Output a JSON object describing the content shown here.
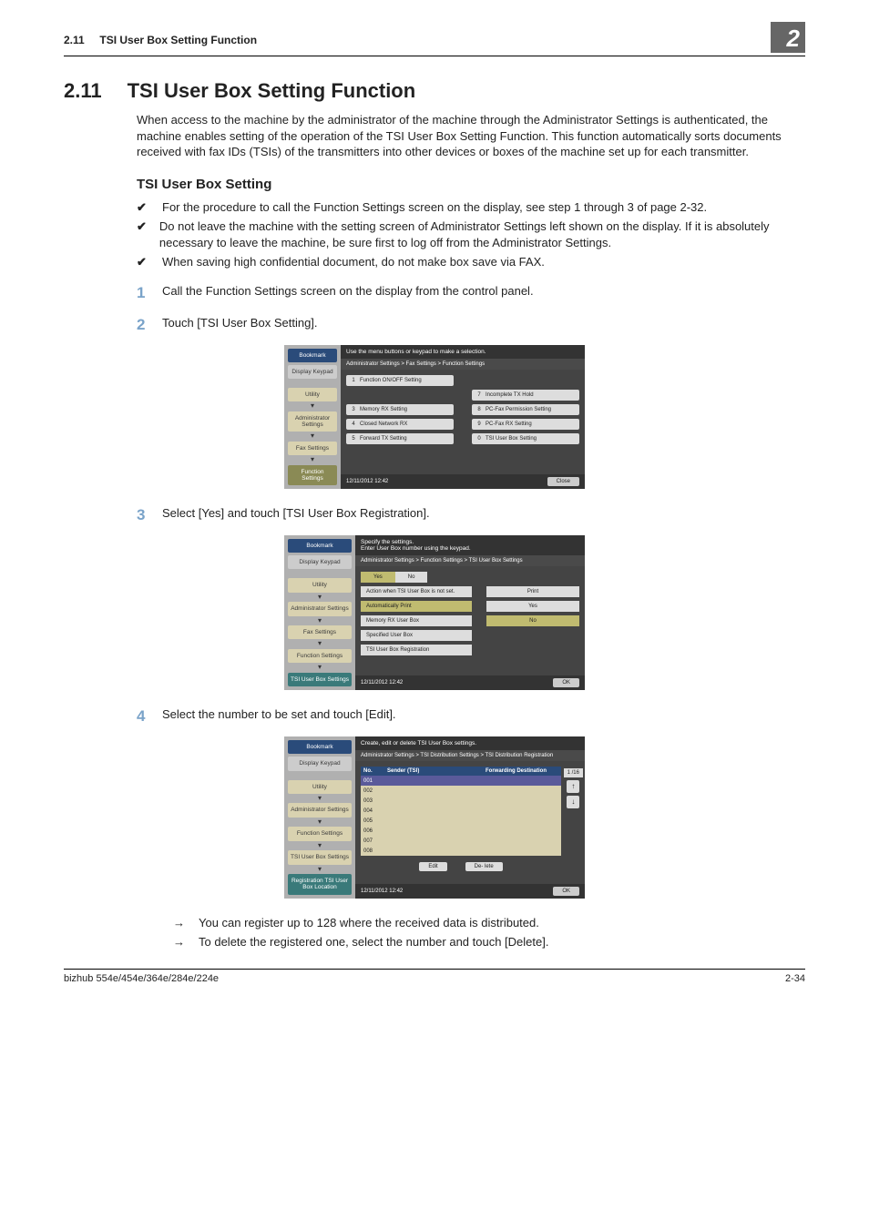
{
  "running_head": {
    "section": "2.11",
    "title": "TSI User Box Setting Function",
    "chapter": "2"
  },
  "h1": {
    "num": "2.11",
    "title": "TSI User Box Setting Function"
  },
  "intro": "When access to the machine by the administrator of the machine through the Administrator Settings is authenticated, the machine enables setting of the operation of the TSI User Box Setting Function. This function automatically sorts documents received with fax IDs (TSIs) of the transmitters into other devices or boxes of the machine set up for each transmitter.",
  "h2": "TSI User Box Setting",
  "checks": [
    "For the procedure to call the Function Settings screen on the display, see step 1 through 3 of page 2-32.",
    "Do not leave the machine with the setting screen of Administrator Settings left shown on the display. If it is absolutely necessary to leave the machine, be sure first to log off from the Administrator Settings.",
    "When saving high confidential document, do not make box save via FAX."
  ],
  "steps": [
    {
      "n": "1",
      "t": "Call the Function Settings screen on the display from the control panel."
    },
    {
      "n": "2",
      "t": "Touch [TSI User Box Setting]."
    },
    {
      "n": "3",
      "t": "Select [Yes] and touch [TSI User Box Registration]."
    },
    {
      "n": "4",
      "t": "Select the number to be set and touch [Edit]."
    }
  ],
  "arrows": [
    "You can register up to 128 where the received data is distributed.",
    "To delete the registered one, select the number and touch [Delete]."
  ],
  "shot_common": {
    "side": {
      "bookmark": "Bookmark",
      "display_keypad": "Display Keypad",
      "utility": "Utility",
      "admin": "Administrator Settings",
      "fax": "Fax Settings",
      "func": "Function Settings",
      "tsi_settings": "TSI User Box Settings",
      "reg_tsi": "Registration TSI User Box Location"
    },
    "datetime": "12/11/2012    12:42",
    "close": "Close",
    "ok": "OK"
  },
  "shot1": {
    "topmsg": "Use the menu buttons or keypad to make a selection.",
    "crumb": "Administrator Settings > Fax Settings > Function Settings",
    "left": [
      {
        "n": "1",
        "l": "Function ON/OFF Setting"
      },
      {
        "n": "3",
        "l": "Memory RX Setting"
      },
      {
        "n": "4",
        "l": "Closed Network RX"
      },
      {
        "n": "5",
        "l": "Forward TX Setting"
      }
    ],
    "right": [
      {
        "n": "7",
        "l": "Incomplete TX Hold"
      },
      {
        "n": "8",
        "l": "PC-Fax Permission Setting"
      },
      {
        "n": "9",
        "l": "PC-Fax RX Setting"
      },
      {
        "n": "0",
        "l": "TSI User Box Setting"
      }
    ]
  },
  "shot2": {
    "topmsg": "Specify the settings.\nEnter User Box number using the keypad.",
    "crumb": "Administrator Settings > Function Settings > TSI User Box Settings",
    "tabs": {
      "yes": "Yes",
      "no": "No"
    },
    "rows": [
      {
        "l": "Action when TSI User Box is not set.",
        "v": "Print"
      },
      {
        "l": "Automatically Print",
        "v": "Yes",
        "sel_l": true
      },
      {
        "l": "Memory RX User Box",
        "v": "No",
        "sel_v": true
      },
      {
        "l": "Specified User Box",
        "v": ""
      },
      {
        "l": "TSI User Box Registration",
        "v": ""
      }
    ]
  },
  "shot3": {
    "topmsg": "Create, edit or delete TSI User Box settings.",
    "crumb": "Administrator Settings > TSI Distribution Settings > TSI Distribution Registration",
    "headers": {
      "no": "No.",
      "sender": "Sender (TSI)",
      "dest": "Forwarding Destination"
    },
    "rows": [
      "001",
      "002",
      "003",
      "004",
      "005",
      "006",
      "007",
      "008"
    ],
    "page": "1 /16",
    "edit": "Edit",
    "delete": "De- lete"
  },
  "footer": {
    "left": "bizhub 554e/454e/364e/284e/224e",
    "right": "2-34"
  }
}
